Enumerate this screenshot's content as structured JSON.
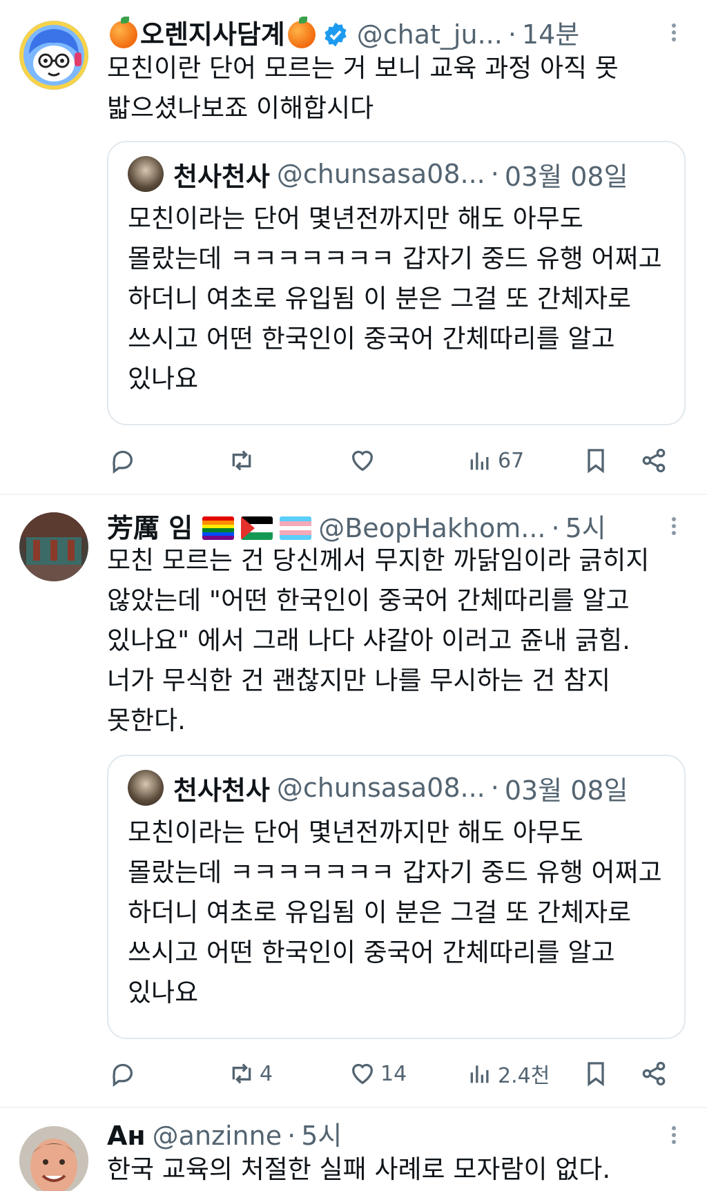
{
  "tweets": [
    {
      "name": "오렌지사담계",
      "handle": "@chat_ju...",
      "time": "14분",
      "text": "모친이란 단어 모르는 거 보니 교육 과정 아직 못\n밟으셨나보죠 이해합시다",
      "quote": {
        "name": "천사천사",
        "handle": "@chunsasa08...",
        "time": "03월 08일",
        "text": "모친이라는 단어 몇년전까지만 해도 아무도\n몰랐는데 ㅋㅋㅋㅋㅋㅋㅋ 갑자기 중드 유행 어쩌고\n하더니 여초로 유입됨 이 분은 그걸 또 간체자로\n쓰시고 어떤 한국인이 중국어 간체따리를 알고\n있나요"
      },
      "actions": {
        "reply": "",
        "retweet": "",
        "like": "",
        "views": "67"
      }
    },
    {
      "name": "芳厲 임",
      "handle": "@BeopHakhom...",
      "time": "5시",
      "text": "모친 모르는 건 당신께서 무지한 까닭임이라 긁히지\n않았는데 \"어떤 한국인이 중국어 간체따리를 알고\n있나요\" 에서 그래 나다 샤갈아 이러고 쥰내 긁힘.\n너가 무식한 건 괜찮지만 나를 무시하는 건 참지\n못한다.",
      "quote": {
        "name": "천사천사",
        "handle": "@chunsasa08...",
        "time": "03월 08일",
        "text": "모친이라는 단어 몇년전까지만 해도 아무도\n몰랐는데 ㅋㅋㅋㅋㅋㅋㅋ 갑자기 중드 유행 어쩌고\n하더니 여초로 유입됨 이 분은 그걸 또 간체자로\n쓰시고 어떤 한국인이 중국어 간체따리를 알고\n있나요"
      },
      "actions": {
        "reply": "",
        "retweet": "4",
        "like": "14",
        "views": "2.4천"
      }
    },
    {
      "name": "Ан",
      "handle": "@anzinne",
      "time": "5시",
      "text": "한국 교육의 처절한 실패 사례로 모자람이 없다."
    }
  ],
  "colors": {
    "verified": "#1d9bf0",
    "muted": "#536471",
    "border": "#e1e8ed"
  },
  "icons": [
    "reply-icon",
    "retweet-icon",
    "like-icon",
    "views-icon",
    "bookmark-icon",
    "share-icon",
    "more-icon",
    "verified-icon"
  ]
}
